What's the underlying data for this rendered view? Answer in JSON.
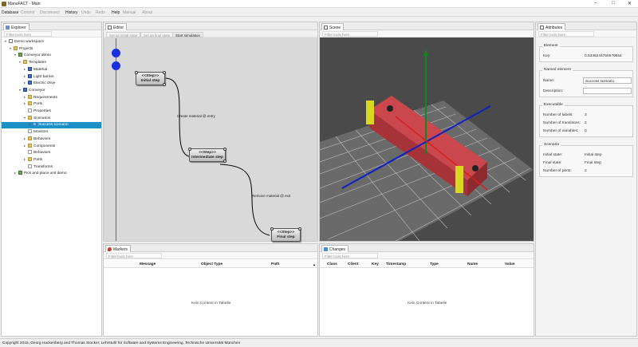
{
  "window": {
    "title": "ManuFACT - Main",
    "minimize": "–",
    "maximize": "□",
    "close": "✕"
  },
  "menu": {
    "items": [
      {
        "label": "Database",
        "enabled": true
      },
      {
        "label": "Commit",
        "enabled": false
      },
      {
        "label": "Disconnect",
        "enabled": false
      },
      {
        "label": "History",
        "enabled": true
      },
      {
        "label": "Undo",
        "enabled": false
      },
      {
        "label": "Redo",
        "enabled": false
      },
      {
        "label": "Help",
        "enabled": true
      },
      {
        "label": "Manual",
        "enabled": false
      },
      {
        "label": "About",
        "enabled": false
      }
    ]
  },
  "filter_placeholder": "Filter tools here",
  "explorer": {
    "tab": "Explorer",
    "tree": [
      {
        "label": "Demo workspace",
        "depth": 0,
        "arrow": "▾",
        "icon": "ws"
      },
      {
        "label": "Projects",
        "depth": 1,
        "arrow": "▾",
        "icon": "folder"
      },
      {
        "label": "Conveyor demo",
        "depth": 2,
        "arrow": "▾",
        "icon": "proj"
      },
      {
        "label": "Templates",
        "depth": 3,
        "arrow": "▾",
        "icon": "folder"
      },
      {
        "label": "Material",
        "depth": 4,
        "arrow": "▸",
        "icon": "blue"
      },
      {
        "label": "Light barrier",
        "depth": 4,
        "arrow": "▸",
        "icon": "blue"
      },
      {
        "label": "Electric drive",
        "depth": 4,
        "arrow": "▸",
        "icon": "blue"
      },
      {
        "label": "Conveyor",
        "depth": 3,
        "arrow": "▾",
        "icon": "blue"
      },
      {
        "label": "Requirements",
        "depth": 4,
        "arrow": "▸",
        "icon": "folder"
      },
      {
        "label": "Ports",
        "depth": 4,
        "arrow": "▸",
        "icon": "folder"
      },
      {
        "label": "Properties",
        "depth": 4,
        "arrow": "",
        "icon": "leaf"
      },
      {
        "label": "Scenarios",
        "depth": 4,
        "arrow": "▾",
        "icon": "folder"
      },
      {
        "label": "Success scenario",
        "depth": 5,
        "arrow": "▸",
        "icon": "scen",
        "selected": true
      },
      {
        "label": "Monitors",
        "depth": 4,
        "arrow": "",
        "icon": "leaf"
      },
      {
        "label": "Behaviors",
        "depth": 4,
        "arrow": "▸",
        "icon": "folder"
      },
      {
        "label": "Components",
        "depth": 4,
        "arrow": "▸",
        "icon": "folder"
      },
      {
        "label": "Behaviors",
        "depth": 4,
        "arrow": "",
        "icon": "leaf"
      },
      {
        "label": "Parts",
        "depth": 4,
        "arrow": "▸",
        "icon": "folder"
      },
      {
        "label": "Transforms",
        "depth": 4,
        "arrow": "",
        "icon": "leaf"
      },
      {
        "label": "Pick and place unit demo",
        "depth": 2,
        "arrow": "▸",
        "icon": "proj"
      }
    ]
  },
  "editor": {
    "tab": "Editor",
    "toolbar": [
      {
        "label": "Set as initial state",
        "on": false
      },
      {
        "label": "Set as final state",
        "on": false
      },
      {
        "label": "Start simulation",
        "on": true
      }
    ],
    "steps": [
      {
        "stereotype": "<<Step>>",
        "name": "Initial step"
      },
      {
        "stereotype": "<<Step>>",
        "name": "Intermediate step"
      },
      {
        "stereotype": "<<Step>>",
        "name": "Final step"
      }
    ],
    "transitions": [
      "Create material @ entry",
      "Remove material @ exit"
    ]
  },
  "scene": {
    "tab": "Scene"
  },
  "attributes": {
    "tab": "Attributes",
    "element": {
      "title": "Element",
      "key_label": "Key:",
      "key_value": "0.5336244750570654"
    },
    "named_element": {
      "title": "Named element",
      "name_label": "Name:",
      "name_value": "Success scenario",
      "desc_label": "Description:",
      "desc_value": ""
    },
    "executable": {
      "title": "Executable",
      "rows": [
        {
          "label": "Number of labels:",
          "value": "3"
        },
        {
          "label": "Number of transitions:",
          "value": "2"
        },
        {
          "label": "Number of variables:",
          "value": "0"
        }
      ]
    },
    "scenario": {
      "title": "Scenario",
      "rows": [
        {
          "label": "Initial state:",
          "value": "Initial step"
        },
        {
          "label": "Final state:",
          "value": "Final step"
        },
        {
          "label": "Number of ports:",
          "value": "2"
        }
      ]
    }
  },
  "markers": {
    "tab": "Markers",
    "columns": [
      "Message",
      "Object Type",
      "Path"
    ],
    "sort_indicator": "▲",
    "empty": "Kein Content in Tabelle"
  },
  "changes": {
    "tab": "Changes",
    "columns": [
      "Class",
      "Client",
      "Key",
      "Timestamp",
      "Type",
      "Name",
      "Value"
    ],
    "empty": "Kein Content in Tabelle"
  },
  "status": "Copyright 2015, Georg Hackenberg and Thomas Stocker, Lehrstuhl für Software and Systems Engineering, Technische Universität München"
}
